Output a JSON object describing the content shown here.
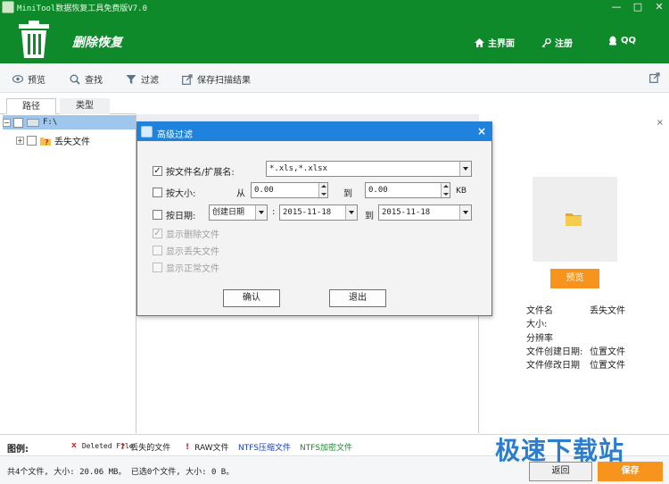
{
  "app": {
    "window_title": "MiniTool数据恢复工具免费版V7.0",
    "header_title": "删除恢复",
    "nav": {
      "home": "主界面",
      "register": "注册",
      "qq": "QQ"
    },
    "window_buttons": [
      "—",
      "□",
      "✕"
    ]
  },
  "toolbar": {
    "preview": "预览",
    "find": "查找",
    "filter": "过滤",
    "save_scan": "保存扫描结果"
  },
  "tabs": {
    "path": "路径",
    "type": "类型",
    "active": "路径"
  },
  "tree": [
    {
      "label": "F:\\",
      "selected": true,
      "expand": "−"
    },
    {
      "label": "丢失文件",
      "selected": false,
      "expand": "+"
    }
  ],
  "dialog": {
    "title": "高级过滤",
    "by_name": {
      "label": "按文件名/扩展名:",
      "checked": true,
      "value": "*.xls,*.xlsx"
    },
    "by_size": {
      "label": "按大小:",
      "checked": false,
      "from_label": "从",
      "from_value": "0.00",
      "to_label": "到",
      "to_value": "0.00",
      "unit": "KB"
    },
    "by_date": {
      "label": "按日期:",
      "checked": false,
      "type_value": "创建日期",
      "colon": ":",
      "from_value": "2015-11-18",
      "to_label": "到",
      "to_value": "2015-11-18"
    },
    "show_deleted": {
      "label": "显示删除文件",
      "checked": true
    },
    "show_lost": {
      "label": "显示丢失文件",
      "checked": false
    },
    "show_normal": {
      "label": "显示正常文件",
      "checked": false
    },
    "ok": "确认",
    "exit": "退出"
  },
  "preview_panel": {
    "close": "×",
    "button": "预览",
    "fields": [
      {
        "label": "文件名",
        "value": "丢失文件"
      },
      {
        "label": "大小:",
        "value": ""
      },
      {
        "label": "分辨率",
        "value": ""
      },
      {
        "label": "文件创建日期:",
        "value": "位置文件"
      },
      {
        "label": "文件修改日期",
        "value": "位置文件"
      }
    ]
  },
  "legend": {
    "title": "图例:",
    "items": [
      {
        "mark": "x",
        "text": "Deleted File",
        "color": "#d9262b"
      },
      {
        "mark": "?",
        "text": "丢失的文件",
        "color": "#d9262b"
      },
      {
        "mark": "!",
        "text": "RAW文件",
        "color": "#d9262b"
      },
      {
        "mark": "",
        "text": "NTFS压缩文件",
        "color": "#1a3fb8"
      },
      {
        "mark": "",
        "text": "NTFS加密文件",
        "color": "#1a8a2a"
      }
    ]
  },
  "status": {
    "text": "共4个文件, 大小: 20.06 MB。 已选0个文件, 大小: 0 B。",
    "back": "返回",
    "save": "保存"
  },
  "watermark": "极速下载站",
  "colors": {
    "header": "#0e8a2b",
    "accent": "#f7941d",
    "dialog_title": "#1f83dd"
  }
}
